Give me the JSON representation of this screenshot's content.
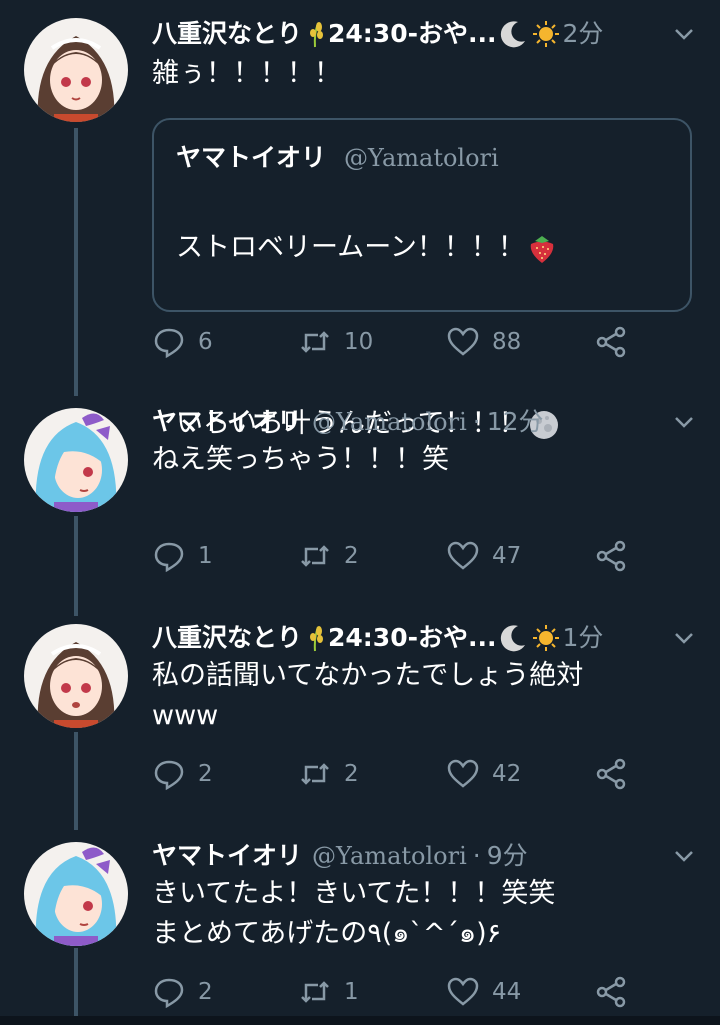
{
  "colors": {
    "background": "#15202b",
    "muted": "#8899a6",
    "border": "#3d5466",
    "text": "#ffffff"
  },
  "tweets": [
    {
      "display_name": "八重沢なとり",
      "status_suffix": "24:30-おや...",
      "time": "2分",
      "text": "雑ぅ！！！！！",
      "quote": {
        "display_name": "ヤマトイオリ",
        "handle": "@Yamatolori",
        "line1": "ストロベリームーン！！！！",
        "line2": "いろいろ叶うんだって！！！"
      },
      "replies": "6",
      "retweets": "10",
      "likes": "88"
    },
    {
      "display_name": "ヤマトイオリ",
      "handle": "@Yamatolori",
      "time": "12分",
      "text": "ねえ笑っちゃう！！！笑",
      "replies": "1",
      "retweets": "2",
      "likes": "47"
    },
    {
      "display_name": "八重沢なとり",
      "status_suffix": "24:30-おや...",
      "time": "1分",
      "text": "私の話聞いてなかったでしょう絶対\nwww",
      "replies": "2",
      "retweets": "2",
      "likes": "42"
    },
    {
      "display_name": "ヤマトイオリ",
      "handle": "@Yamatolori",
      "time": "9分",
      "text": "きいてたよ！きいてた！！！笑笑\nまとめてあげたの٩(๑`^´๑)۶",
      "replies": "2",
      "retweets": "1",
      "likes": "44"
    }
  ],
  "icons": [
    "reply-icon",
    "retweet-icon",
    "like-icon",
    "share-icon",
    "chevron-down-icon",
    "crescent-moon-icon",
    "sun-icon",
    "rice-icon",
    "strawberry-icon",
    "full-moon-icon"
  ]
}
